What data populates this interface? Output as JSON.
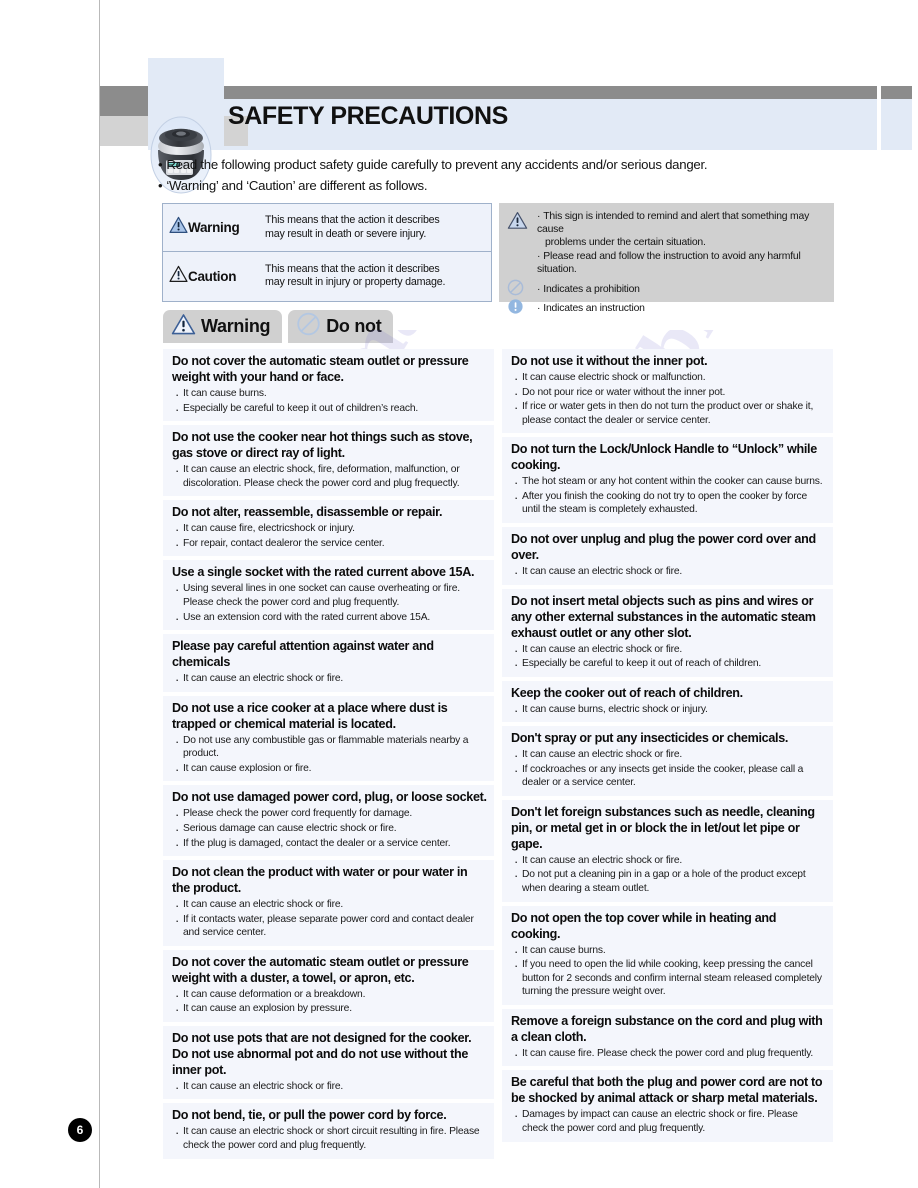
{
  "page": {
    "number": "6",
    "title": "SAFETY PRECAUTIONS",
    "accent_blue": "#e2eaf6",
    "accent_gray": "#8c8c8c",
    "block_bg": "#f4f6fc",
    "badge_bg": "#d0d0d0"
  },
  "intro": {
    "line1": "Read the following product safety guide carefully to prevent any accidents and/or serious danger.",
    "line2": "‘Warning’ and ‘Caution’ are different as follows.",
    "bullet": "•"
  },
  "definitions": {
    "left": [
      {
        "icon": "warning-triangle-icon",
        "label": "Warning",
        "line1": "This means that the action it describes",
        "line2": "may result in death or severe injury."
      },
      {
        "icon": "warning-triangle-icon",
        "label": "Caution",
        "line1": "This means that the action it describes",
        "line2": "may result in injury or property damage."
      }
    ],
    "right": {
      "sign": {
        "icon": "warning-triangle-icon",
        "lines": [
          "This sign is intended to remind and alert that something may cause",
          "problems under the certain situation.",
          "Please read and follow the instruction to avoid any harmful situation."
        ]
      },
      "prohibition": {
        "icon": "prohibition-icon",
        "text": "Indicates a prohibition"
      },
      "instruction": {
        "icon": "instruction-icon",
        "text": "Indicates an instruction"
      },
      "bullet": "·"
    }
  },
  "badges": [
    {
      "icon": "warning-triangle-icon",
      "label": "Warning"
    },
    {
      "icon": "prohibition-icon",
      "label": "Do not"
    }
  ],
  "columns": {
    "left": [
      {
        "title": "Do not cover the automatic steam outlet or pressure weight with your hand or face.",
        "items": [
          "It can cause burns.",
          "Especially be careful to keep it out of children’s reach."
        ]
      },
      {
        "title": "Do not use the cooker near hot things such as stove, gas stove or direct ray of light.",
        "items": [
          "It can cause an electric shock, fire, deformation, malfunction, or discoloration. Please check the power cord and plug frequectly."
        ]
      },
      {
        "title": "Do not alter, reassemble, disassemble or repair.",
        "items": [
          "It can cause fire, electricshock or injury.",
          "For repair, contact dealeror the service center."
        ]
      },
      {
        "title": "Use a single socket with the rated current above 15A.",
        "items": [
          "Using several lines in one socket can cause overheating or fire. Please check the power cord and plug frequently.",
          "Use an extension cord with the rated current above 15A."
        ]
      },
      {
        "title": "Please pay careful attention against water and chemicals",
        "items": [
          "It can cause an electric shock or fire."
        ]
      },
      {
        "title": "Do not use a rice cooker at a place where dust is trapped or chemical material is located.",
        "items": [
          "Do not use any combustible gas or flammable materials nearby a product.",
          "It can cause explosion or fire."
        ]
      },
      {
        "title": "Do not use damaged power cord, plug, or loose socket.",
        "items": [
          "Please check the power cord frequently for damage.",
          "Serious damage can cause electric shock or fire.",
          "If the plug is damaged, contact the dealer or a service center."
        ]
      },
      {
        "title": "Do not clean the product with water or pour water in the product.",
        "items": [
          "It can cause an electric shock or fire.",
          "If it contacts water, please separate power cord and contact dealer and service center."
        ]
      },
      {
        "title": "Do not cover the automatic steam outlet or pressure weight with a duster, a towel, or apron, etc.",
        "items": [
          "It can cause deformation or a breakdown.",
          "It can cause an explosion by pressure."
        ]
      },
      {
        "title": "Do not use pots that are not designed for the cooker. Do not use abnormal pot and do not use without the inner pot.",
        "items": [
          "It can cause an electric shock or fire."
        ]
      },
      {
        "title": "Do not bend, tie, or pull the power cord by force.",
        "items": [
          "It can cause an electric shock or short circuit resulting in fire. Please check the power cord and plug frequently."
        ]
      }
    ],
    "right": [
      {
        "title": "Do not use it without the inner pot.",
        "items": [
          "It can cause electric shock or malfunction.",
          "Do not pour rice or water without the inner pot.",
          "If rice or water gets in then do not turn the product over or shake it, please contact the dealer or service center."
        ]
      },
      {
        "title": "Do not turn the Lock/Unlock Handle to “Unlock” while cooking.",
        "items": [
          "The hot steam or any hot content within the cooker can cause burns.",
          "After you finish the cooking do not try to open the cooker by force until the steam is completely exhausted."
        ]
      },
      {
        "title": "Do not over unplug and plug the power cord over and over.",
        "items": [
          "It can cause an electric shock or fire."
        ]
      },
      {
        "title": "Do not insert metal objects such as pins and wires or any other external substances in the automatic steam exhaust outlet or any other slot.",
        "items": [
          "It can cause an electric shock or fire.",
          "Especially be careful to keep it out of reach of children."
        ]
      },
      {
        "title": "Keep the cooker out of reach of children.",
        "items": [
          "It can cause burns, electric shock or injury."
        ]
      },
      {
        "title": "Don't spray or put any insecticides or chemicals.",
        "items": [
          "It can cause an electric shock or fire.",
          "If cockroaches or any insects get inside the cooker, please call a dealer or a service center."
        ]
      },
      {
        "title": "Don't let foreign substances such as needle, cleaning pin, or metal get in or block the in let/out let pipe or gape.",
        "items": [
          "It can cause an electric shock or fire.",
          "Do not put a cleaning pin in a gap or a hole of the product except when dearing a steam outlet."
        ]
      },
      {
        "title": "Do not open the top cover while in heating and cooking.",
        "items": [
          "It can cause burns.",
          "If you need to open the lid while cooking, keep pressing the cancel button for 2 seconds and confirm internal steam released completely turning the pressure weight over."
        ]
      },
      {
        "title": "Remove a foreign substance on the cord and plug with a clean cloth.",
        "items": [
          "It can cause fire. Please check the power cord and plug frequently."
        ]
      },
      {
        "title": "Be careful that both the plug and power cord are not to be shocked by animal attack or sharp metal materials.",
        "items": [
          "Damages by impact can cause an electric shock or fire. Please check the power cord and plug frequently."
        ]
      }
    ]
  },
  "watermark": {
    "part1": "manualsli",
    "part2": "brary.com"
  }
}
